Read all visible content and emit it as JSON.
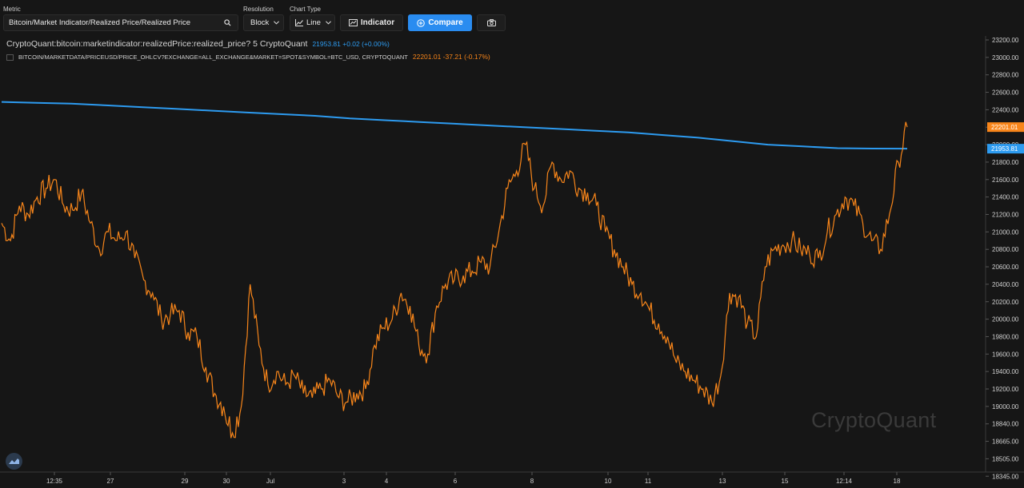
{
  "toolbar": {
    "metric_label": "Metric",
    "metric_value": "Bitcoin/Market Indicator/Realized Price/Realized Price",
    "resolution_label": "Resolution",
    "resolution_value": "Block",
    "chart_type_label": "Chart Type",
    "chart_type_value": "Line",
    "indicator_label": "Indicator",
    "compare_label": "Compare",
    "accent": "#2a8cf0"
  },
  "legend": {
    "series1_name": "CryptoQuant:bitcoin:marketindicator:realizedPrice:realized_price?  5  CryptoQuant",
    "series1_value": "21953.81  +0.02 (+0.00%)",
    "series2_name": "BITCOIN/MARKETDATA/PRICEUSD/PRICE_OHLCV?EXCHANGE=ALL_EXCHANGE&MARKET=SPOT&SYMBOL=BTC_USD, CRYPTOQUANT",
    "series2_value": "22201.01  -37.21 (-0.17%)"
  },
  "watermark": "CryptoQuant",
  "chart_data": {
    "type": "line",
    "y_ticks": [
      "23200.00",
      "23000.00",
      "22800.00",
      "22600.00",
      "22400.00",
      "22200.00",
      "22000.00",
      "21800.00",
      "21600.00",
      "21400.00",
      "21200.00",
      "21000.00",
      "20800.00",
      "20600.00",
      "20400.00",
      "20200.00",
      "20000.00",
      "19800.00",
      "19600.00",
      "19400.00",
      "19200.00",
      "19000.00",
      "18840.00",
      "18665.00",
      "18505.00",
      "18345.00"
    ],
    "x_ticks": [
      "12:35",
      "27",
      "29",
      "30",
      "Jul",
      "3",
      "4",
      "6",
      "8",
      "10",
      "11",
      "13",
      "15",
      "12:14",
      "18"
    ],
    "last_value_labels": {
      "price": "22201.01",
      "realized": "21953.81"
    },
    "series": [
      {
        "name": "CryptoQuant:bitcoin:marketindicator:realizedPrice:realized_price?",
        "color": "#2d9bf0",
        "values": [
          22490,
          22480,
          22470,
          22450,
          22430,
          22410,
          22390,
          22370,
          22350,
          22330,
          22300,
          22280,
          22260,
          22240,
          22220,
          22200,
          22180,
          22160,
          22140,
          22110,
          22080,
          22040,
          22000,
          21980,
          21960,
          21955,
          21954
        ]
      },
      {
        "name": "BITCOIN/MARKETDATA/PRICEUSD/PRICE_OHLCV?EXCHANGE=ALL_EXCHANGE&MARKET=SPOT&SYMBOL=BTC_USD",
        "color": "#f7851a",
        "values": [
          21100,
          20900,
          21300,
          21200,
          21400,
          21500,
          21600,
          21300,
          21250,
          21450,
          21100,
          20800,
          21000,
          20900,
          21000,
          20700,
          20450,
          20300,
          20000,
          20050,
          20100,
          19850,
          19800,
          19450,
          19150,
          19000,
          18750,
          19000,
          20400,
          19700,
          19250,
          19400,
          19250,
          19350,
          19150,
          19100,
          19200,
          19300,
          19100,
          19050,
          19150,
          19200,
          19700,
          19900,
          20000,
          20300,
          20150,
          19700,
          19600,
          20150,
          20400,
          20450,
          20500,
          20550,
          20650,
          20600,
          21000,
          21500,
          21700,
          22000,
          21500,
          21300,
          21800,
          21600,
          21700,
          21500,
          21450,
          21300,
          21000,
          20800,
          20600,
          20400,
          20300,
          20100,
          19950,
          19800,
          19500,
          19400,
          19300,
          19200,
          19050,
          19350,
          20300,
          20250,
          19950,
          19800,
          20600,
          20800,
          20850,
          20900,
          20800,
          20750,
          20700,
          21000,
          21200,
          21400,
          21300,
          21100,
          20900,
          20800,
          21200,
          21800,
          22201
        ]
      }
    ]
  }
}
